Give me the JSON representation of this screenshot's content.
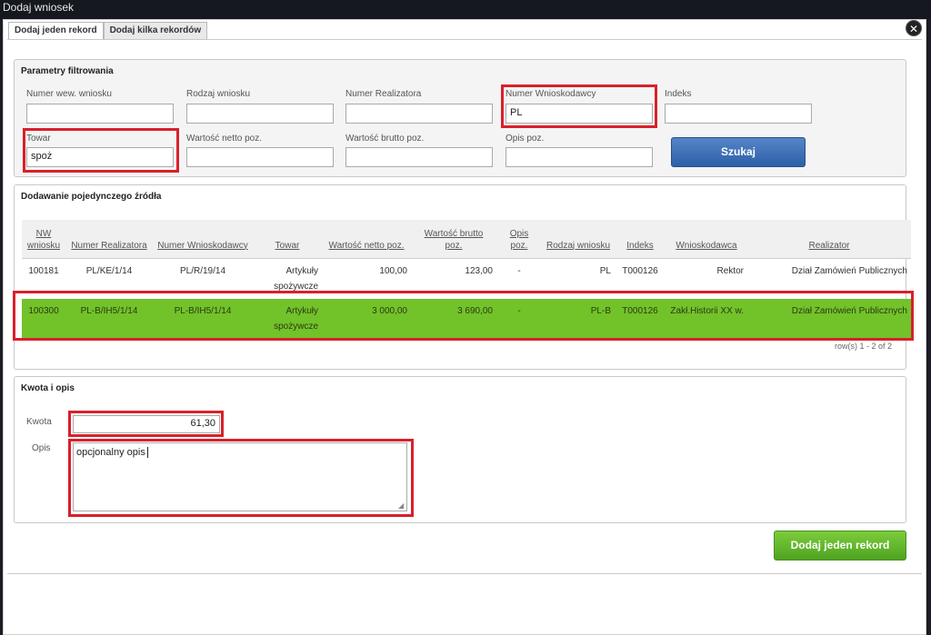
{
  "window": {
    "title": "Dodaj wniosek",
    "close_label": "✕"
  },
  "tabs": [
    {
      "label": "Dodaj jeden rekord",
      "active": true
    },
    {
      "label": "Dodaj kilka rekordów",
      "active": false
    }
  ],
  "filters": {
    "title": "Parametry filtrowania",
    "fields": {
      "nr_wew": {
        "label": "Numer wew. wniosku",
        "value": ""
      },
      "rodzaj": {
        "label": "Rodzaj wniosku",
        "value": ""
      },
      "nr_realizatora": {
        "label": "Numer Realizatora",
        "value": ""
      },
      "nr_wnioskodawcy": {
        "label": "Numer Wnioskodawcy",
        "value": "PL"
      },
      "indeks": {
        "label": "Indeks",
        "value": ""
      },
      "towar": {
        "label": "Towar",
        "value": "spoż"
      },
      "netto": {
        "label": "Wartość netto poz.",
        "value": ""
      },
      "brutto": {
        "label": "Wartość brutto poz.",
        "value": ""
      },
      "opis_poz": {
        "label": "Opis poz.",
        "value": ""
      }
    },
    "search_label": "Szukaj"
  },
  "source": {
    "title": "Dodawanie pojedynczego źródła",
    "columns": [
      "NW wniosku",
      "Numer Realizatora",
      "Numer Wnioskodawcy",
      "Towar",
      "Wartość netto poz.",
      "Wartość brutto poz.",
      "Opis poz.",
      "Rodzaj wniosku",
      "Indeks",
      "Wnioskodawca",
      "Realizator"
    ],
    "rows": [
      [
        "100181",
        "PL/KE/1/14",
        "PL/R/19/14",
        "Artykuły spożywcze",
        "100,00",
        "123,00",
        "-",
        "PL",
        "T000126",
        "Rektor",
        "Dział Zamówień Publicznych"
      ],
      [
        "100300",
        "PL-B/IH5/1/14",
        "PL-B/IH5/1/14",
        "Artykuły spożywcze",
        "3 000,00",
        "3 690,00",
        "-",
        "PL-B",
        "T000126",
        "Zakł.Historii XX w.",
        "Dział Zamówień Publicznych"
      ]
    ],
    "selected_row": 1,
    "rows_info": "row(s) 1 - 2 of 2"
  },
  "amount": {
    "title": "Kwota i opis",
    "kwota_label": "Kwota",
    "kwota_value": "61,30",
    "opis_label": "Opis",
    "opis_value": "opcjonalny opis"
  },
  "add_button_label": "Dodaj jeden rekord",
  "colors": {
    "highlight": "#d9202a",
    "search_button": "#2d5fa8",
    "selected_row": "#72c22a",
    "add_button": "#4ea321"
  }
}
